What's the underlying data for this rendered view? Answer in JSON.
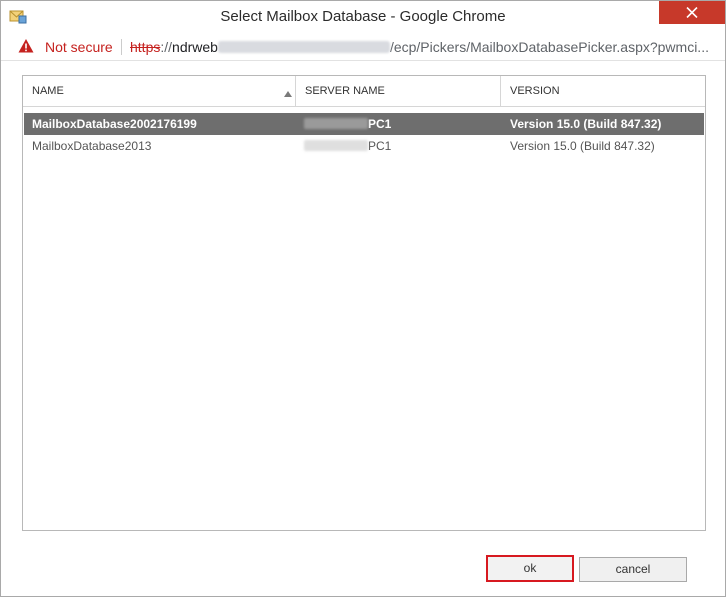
{
  "window": {
    "title": "Select Mailbox Database - Google Chrome"
  },
  "address_bar": {
    "security_label": "Not secure",
    "url_scheme": "https",
    "url_separator": "://",
    "url_host_visible": "ndrweb",
    "url_path": "/ecp/Pickers/MailboxDatabasePicker.aspx?pwmci..."
  },
  "grid": {
    "columns": [
      {
        "label": "NAME"
      },
      {
        "label": "SERVER NAME"
      },
      {
        "label": "VERSION"
      }
    ],
    "rows": [
      {
        "name": "MailboxDatabase2002176199",
        "server_suffix": "PC1",
        "version": "Version 15.0 (Build 847.32)",
        "selected": true
      },
      {
        "name": "MailboxDatabase2013",
        "server_suffix": "PC1",
        "version": "Version 15.0 (Build 847.32)",
        "selected": false
      }
    ]
  },
  "buttons": {
    "ok_label": "ok",
    "cancel_label": "cancel"
  },
  "colors": {
    "close_button": "#c7392a",
    "selected_row": "#6e6e6e",
    "ok_highlight": "#d71920",
    "not_secure": "#c5221f"
  },
  "icons": {
    "app": "mailbox-envelope-icon",
    "close": "close-icon",
    "warning": "warning-triangle-icon",
    "sort": "sort-ascending-icon"
  }
}
